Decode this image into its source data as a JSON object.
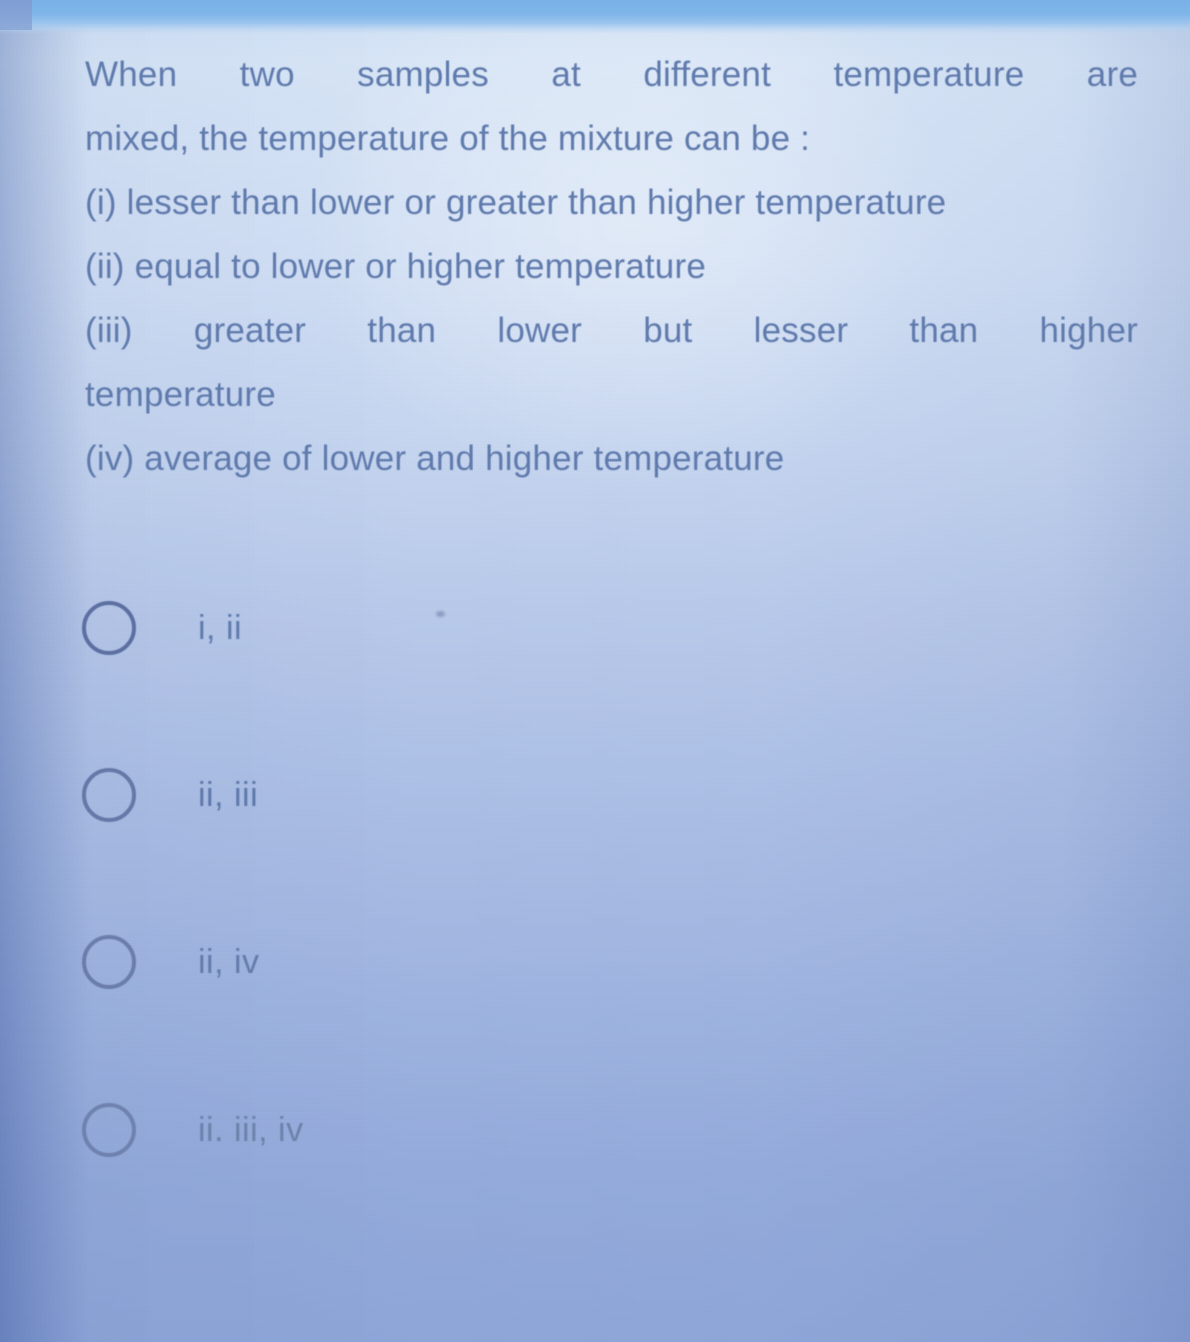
{
  "screen": {
    "background_top_color": "#d8e6f7",
    "background_bottom_color": "#8ea6d9",
    "top_band_color": "#79b2e8",
    "text_color": "#5f7aad",
    "radio_outline_color": "#55689c"
  },
  "question": {
    "lines": [
      "When two samples at different temperature are",
      "mixed, the temperature of the mixture can be :",
      "(i) lesser than lower or greater than higher temperature",
      "(ii) equal to lower or higher temperature",
      "(iii) greater than lower but lesser than higher",
      "temperature",
      "(iv) average of lower and higher temperature"
    ],
    "full_text": "When two samples at different temperature are mixed, the temperature of the mixture can be : (i) lesser than lower or greater than higher temperature (ii) equal to lower or higher temperature (iii) greater than lower but lesser than higher temperature (iv) average of lower and higher temperature"
  },
  "options": [
    {
      "label": "i, ii",
      "selected": false
    },
    {
      "label": "ii, iii",
      "selected": false
    },
    {
      "label": "ii, iv",
      "selected": false
    },
    {
      "label": "ii. iii, iv",
      "selected": false
    }
  ]
}
